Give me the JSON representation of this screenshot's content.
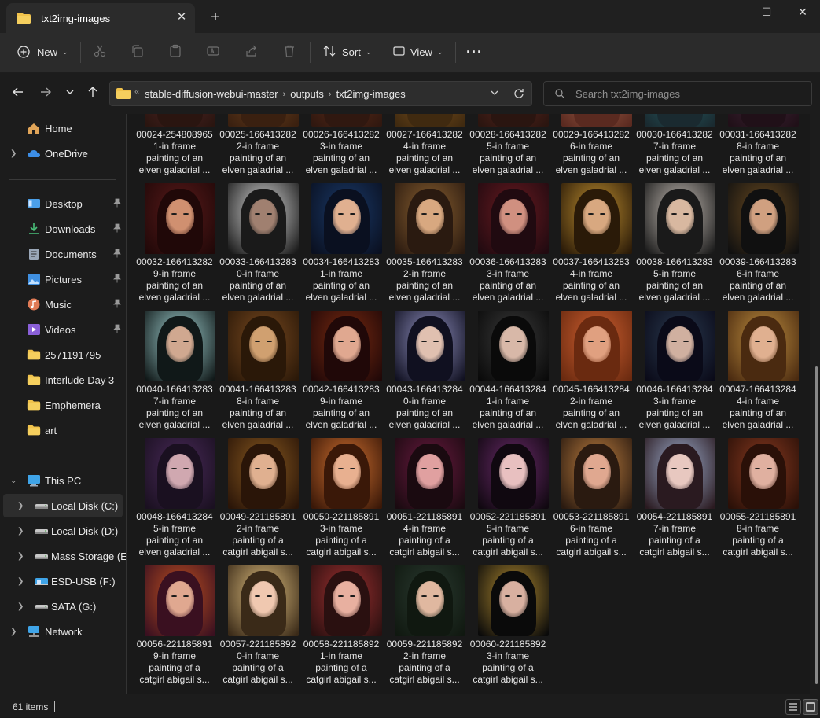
{
  "window": {
    "tab_title": "txt2img-images",
    "new_tab_symbol": "+",
    "close_tab_symbol": "✕",
    "minimize_symbol": "—",
    "maximize_symbol": "☐",
    "close_symbol": "✕"
  },
  "toolbar": {
    "new_label": "New",
    "sort_label": "Sort",
    "view_label": "View",
    "more_symbol": "···",
    "icons": [
      "cut-icon",
      "copy-icon",
      "paste-icon",
      "rename-icon",
      "share-icon",
      "delete-icon"
    ]
  },
  "address": {
    "overflow_symbol": "«",
    "crumbs": [
      "stable-diffusion-webui-master",
      "outputs",
      "txt2img-images"
    ],
    "crumb_separator": "›"
  },
  "search": {
    "placeholder": "Search txt2img-images"
  },
  "sidebar": {
    "items": [
      {
        "label": "Home",
        "icon": "home-icon",
        "color": "#e0a458"
      },
      {
        "label": "OneDrive",
        "icon": "cloud-icon",
        "color": "#3d8ee6",
        "expandable": true
      },
      {
        "label": "Desktop",
        "icon": "desktop-icon",
        "color": "#4b9fe8",
        "pinned": true
      },
      {
        "label": "Downloads",
        "icon": "download-icon",
        "color": "#4ac07a",
        "pinned": true
      },
      {
        "label": "Documents",
        "icon": "document-icon",
        "color": "#9aa7b8",
        "pinned": true
      },
      {
        "label": "Pictures",
        "icon": "pictures-icon",
        "color": "#3f8fe0",
        "pinned": true
      },
      {
        "label": "Music",
        "icon": "music-icon",
        "color": "#e07a55",
        "pinned": true
      },
      {
        "label": "Videos",
        "icon": "video-icon",
        "color": "#8a5fd8",
        "pinned": true
      },
      {
        "label": "2571191795",
        "icon": "folder-icon",
        "color": "#f0c24b"
      },
      {
        "label": "Interlude Day 3",
        "icon": "folder-icon",
        "color": "#f0c24b"
      },
      {
        "label": "Emphemera",
        "icon": "folder-icon",
        "color": "#f0c24b"
      },
      {
        "label": "art",
        "icon": "folder-icon",
        "color": "#f0c24b"
      },
      {
        "label": "This PC",
        "icon": "pc-icon",
        "color": "#3fa4e8",
        "expanded": true
      },
      {
        "label": "Local Disk (C:)",
        "icon": "drive-icon",
        "color": "#c8c8c8",
        "expandable": true,
        "selected": true
      },
      {
        "label": "Local Disk (D:)",
        "icon": "drive-icon",
        "color": "#c8c8c8",
        "expandable": true
      },
      {
        "label": "Mass Storage (E:)",
        "icon": "drive-icon",
        "color": "#c8c8c8",
        "expandable": true
      },
      {
        "label": "ESD-USB (F:)",
        "icon": "usb-drive-icon",
        "color": "#3fa4e8",
        "expandable": true
      },
      {
        "label": "SATA (G:)",
        "icon": "drive-icon",
        "color": "#c8c8c8",
        "expandable": true
      },
      {
        "label": "Network",
        "icon": "network-icon",
        "color": "#3fa4e8",
        "expandable": true
      }
    ]
  },
  "files": [
    {
      "caption": "00024-254808965\n1-in frame\npainting of an\nelven galadrial ...",
      "palette": [
        "#5a2a2a",
        "#c98a5a",
        "#2a1510"
      ]
    },
    {
      "caption": "00025-166413282\n2-in frame\npainting of an\nelven galadrial ...",
      "palette": [
        "#7a4a20",
        "#d7a060",
        "#3a2010"
      ]
    },
    {
      "caption": "00026-166413282\n3-in frame\npainting of an\nelven galadrial ...",
      "palette": [
        "#6a3018",
        "#c98a60",
        "#301810"
      ]
    },
    {
      "caption": "00027-166413282\n4-in frame\npainting of an\nelven galadrial ...",
      "palette": [
        "#8a5a20",
        "#e0a870",
        "#402a10"
      ]
    },
    {
      "caption": "00028-166413282\n5-in frame\npainting of an\nelven galadrial ...",
      "palette": [
        "#6a2a20",
        "#d89080",
        "#2a1510"
      ]
    },
    {
      "caption": "00029-166413282\n6-in frame\npainting of an\nelven galadrial ...",
      "palette": [
        "#b06a50",
        "#e8b090",
        "#5a2a20"
      ]
    },
    {
      "caption": "00030-166413282\n7-in frame\npainting of an\nelven galadrial ...",
      "palette": [
        "#2a6a70",
        "#d8b090",
        "#1a2a30"
      ]
    },
    {
      "caption": "00031-166413282\n8-in frame\npainting of an\nelven galadrial ...",
      "palette": [
        "#4a2a40",
        "#c89080",
        "#201018"
      ]
    },
    {
      "caption": "00032-166413282\n9-in frame\npainting of an\nelven galadrial ...",
      "palette": [
        "#5a1a1a",
        "#d09070",
        "#200808"
      ]
    },
    {
      "caption": "00033-166413283\n0-in frame\npainting of an\nelven galadrial ...",
      "palette": [
        "#d8d8d8",
        "#a08070",
        "#1a1a1a"
      ]
    },
    {
      "caption": "00034-166413283\n1-in frame\npainting of an\nelven galadrial ...",
      "palette": [
        "#1a3a6a",
        "#e0b090",
        "#0a1020"
      ]
    },
    {
      "caption": "00035-166413283\n2-in frame\npainting of an\nelven galadrial ...",
      "palette": [
        "#8a6030",
        "#d8a880",
        "#2a1a10"
      ]
    },
    {
      "caption": "00036-166413283\n3-in frame\npainting of an\nelven galadrial ...",
      "palette": [
        "#6a1a20",
        "#d09080",
        "#200a10"
      ]
    },
    {
      "caption": "00037-166413283\n4-in frame\npainting of an\nelven galadrial ...",
      "palette": [
        "#c09030",
        "#d8a880",
        "#2a1a08"
      ]
    },
    {
      "caption": "00038-166413283\n5-in frame\npainting of an\nelven galadrial ...",
      "palette": [
        "#c8c0b8",
        "#d8b8a0",
        "#1a1a1a"
      ]
    },
    {
      "caption": "00039-166413283\n6-in frame\npainting of an\nelven galadrial ...",
      "palette": [
        "#6a4a20",
        "#d0a080",
        "#101010"
      ]
    },
    {
      "caption": "00040-166413283\n7-in frame\npainting of an\nelven galadrial ...",
      "palette": [
        "#a0d0d0",
        "#d0a890",
        "#101818"
      ]
    },
    {
      "caption": "00041-166413283\n8-in frame\npainting of an\nelven galadrial ...",
      "palette": [
        "#7a4a20",
        "#d0a070",
        "#2a1808"
      ]
    },
    {
      "caption": "00042-166413283\n9-in frame\npainting of an\nelven galadrial ...",
      "palette": [
        "#7a2a10",
        "#e0a890",
        "#200808"
      ]
    },
    {
      "caption": "00043-166413284\n0-in frame\npainting of an\nelven galadrial ...",
      "palette": [
        "#9090c0",
        "#e0c0b0",
        "#101020"
      ]
    },
    {
      "caption": "00044-166413284\n1-in frame\npainting of an\nelven galadrial ...",
      "palette": [
        "#3a3a3a",
        "#d8b8a8",
        "#0a0a0a"
      ]
    },
    {
      "caption": "00045-166413284\n2-in frame\npainting of an\nelven galadrial ...",
      "palette": [
        "#d06030",
        "#e0a080",
        "#6a2a10"
      ]
    },
    {
      "caption": "00046-166413284\n3-in frame\npainting of an\nelven galadrial ...",
      "palette": [
        "#2a3a50",
        "#d0b0a0",
        "#0a0a18"
      ]
    },
    {
      "caption": "00047-166413284\n4-in frame\npainting of an\nelven galadrial ...",
      "palette": [
        "#c09040",
        "#e0b090",
        "#4a2a10"
      ]
    },
    {
      "caption": "00048-166413284\n5-in frame\npainting of an\nelven galadrial ...",
      "palette": [
        "#4a2a5a",
        "#d0a8b0",
        "#1a1020"
      ]
    },
    {
      "caption": "00049-221185891\n2-in frame\npainting of a\ncatgirl abigail s...",
      "palette": [
        "#8a5a20",
        "#e0b090",
        "#2a1508"
      ]
    },
    {
      "caption": "00050-221185891\n3-in frame\npainting of a\ncatgirl abigail s...",
      "palette": [
        "#d07030",
        "#e8b090",
        "#3a1808"
      ]
    },
    {
      "caption": "00051-221185891\n4-in frame\npainting of a\ncatgirl abigail s...",
      "palette": [
        "#6a1a40",
        "#e0a0a0",
        "#1a0a10"
      ]
    },
    {
      "caption": "00052-221185891\n5-in frame\npainting of a\ncatgirl abigail s...",
      "palette": [
        "#6a2a6a",
        "#e8c0c0",
        "#100810"
      ]
    },
    {
      "caption": "00053-221185891\n6-in frame\npainting of a\ncatgirl abigail s...",
      "palette": [
        "#c08040",
        "#e0a890",
        "#2a1a10"
      ]
    },
    {
      "caption": "00054-221185891\n7-in frame\npainting of a\ncatgirl abigail s...",
      "palette": [
        "#a0b0d0",
        "#e8c8c0",
        "#2a1a20"
      ]
    },
    {
      "caption": "00055-221185891\n8-in frame\npainting of a\ncatgirl abigail s...",
      "palette": [
        "#8a3a20",
        "#e0b0a0",
        "#2a1008"
      ]
    },
    {
      "caption": "00056-221185891\n9-in frame\npainting of a\ncatgirl abigail s...",
      "palette": [
        "#c05020",
        "#e0a890",
        "#3a1020"
      ]
    },
    {
      "caption": "00057-221185892\n0-in frame\npainting of a\ncatgirl abigail s...",
      "palette": [
        "#e0c080",
        "#f0c8b0",
        "#3a2a18"
      ]
    },
    {
      "caption": "00058-221185892\n1-in frame\npainting of a\ncatgirl abigail s...",
      "palette": [
        "#a03030",
        "#e8b0a0",
        "#2a1010"
      ]
    },
    {
      "caption": "00059-221185892\n2-in frame\npainting of a\ncatgirl abigail s...",
      "palette": [
        "#2a3a30",
        "#e0b8a0",
        "#101810"
      ]
    },
    {
      "caption": "00060-221185892\n3-in frame\npainting of a\ncatgirl abigail s...",
      "palette": [
        "#b08a30",
        "#d8b0a0",
        "#0a0a0a"
      ]
    }
  ],
  "status": {
    "item_count": "61 items"
  },
  "colors": {
    "background": "#191919",
    "accent": "#4cc2ff",
    "folder": "#f0c24b"
  }
}
